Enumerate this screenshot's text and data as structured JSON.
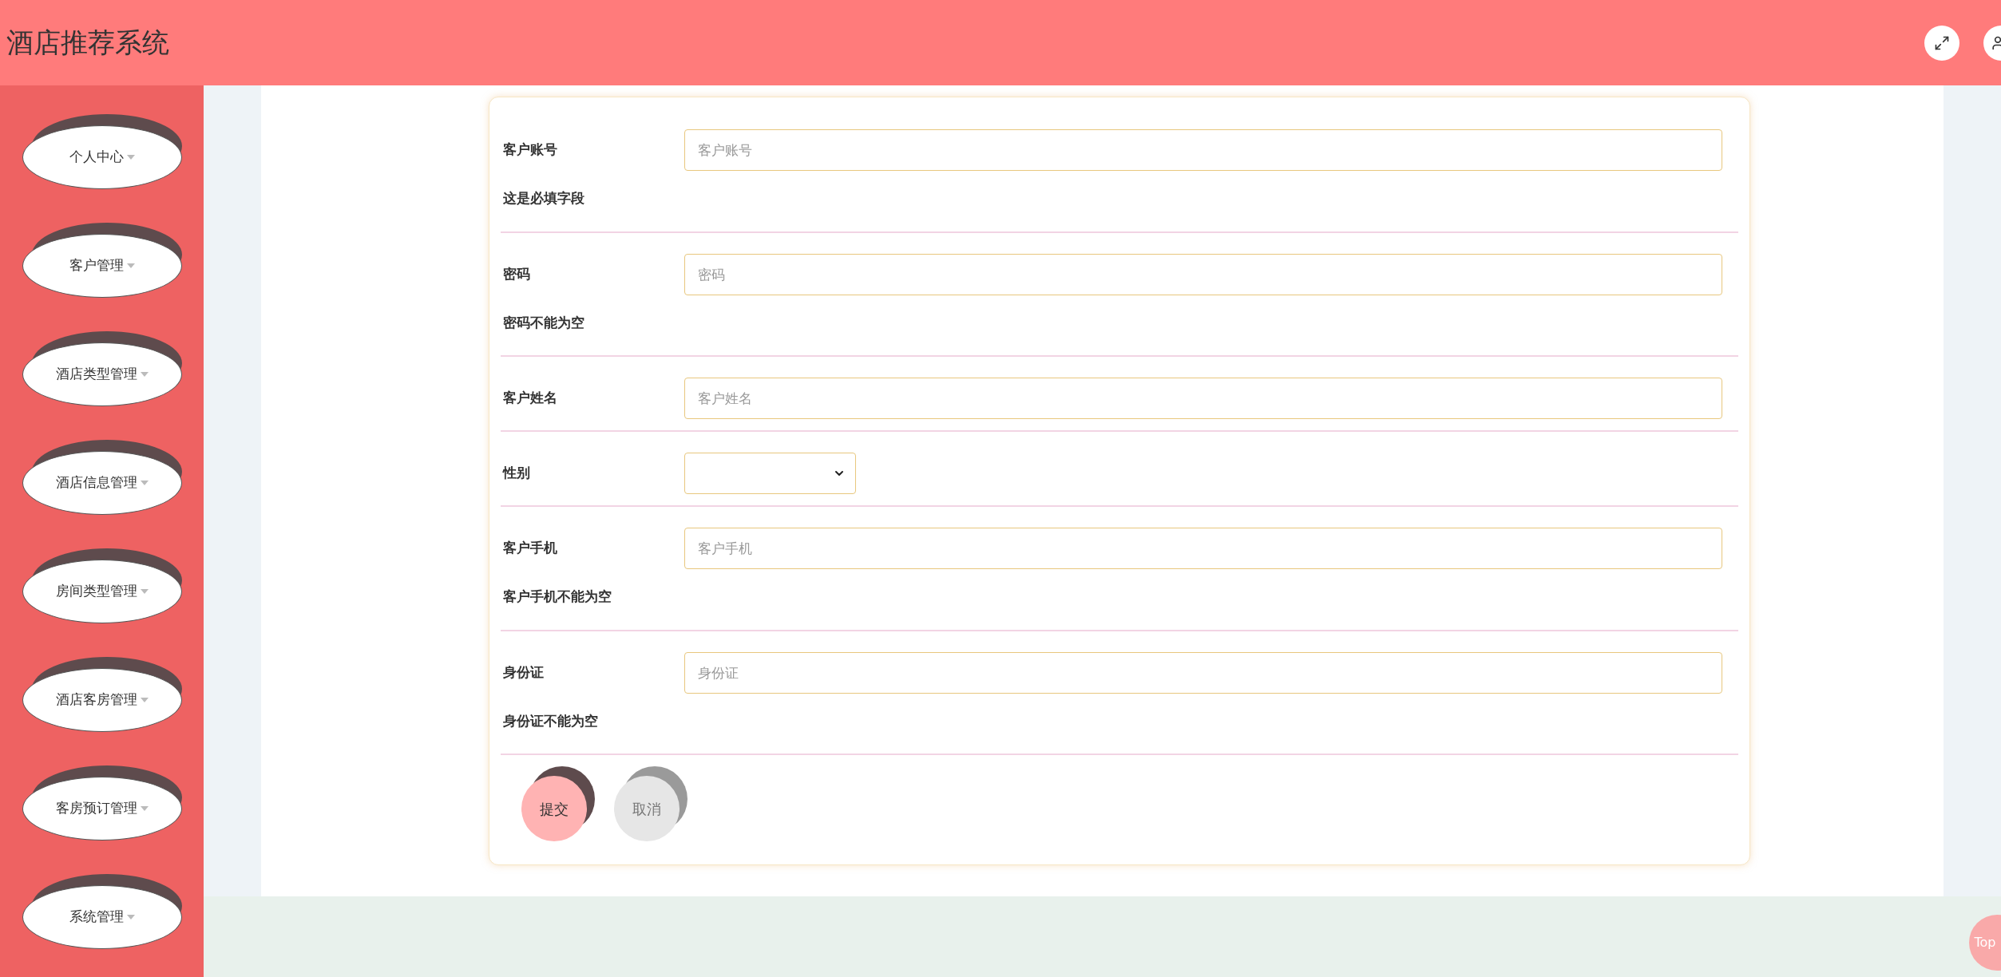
{
  "header": {
    "title": "酒店推荐系统"
  },
  "sidebar": {
    "items": [
      {
        "label": "个人中心"
      },
      {
        "label": "客户管理"
      },
      {
        "label": "酒店类型管理"
      },
      {
        "label": "酒店信息管理"
      },
      {
        "label": "房间类型管理"
      },
      {
        "label": "酒店客房管理"
      },
      {
        "label": "客房预订管理"
      },
      {
        "label": "系统管理"
      }
    ]
  },
  "form": {
    "fields": [
      {
        "kind": "text",
        "label": "客户账号",
        "placeholder": "客户账号",
        "error": "这是必填字段"
      },
      {
        "kind": "text",
        "label": "密码",
        "placeholder": "密码",
        "error": "密码不能为空"
      },
      {
        "kind": "text",
        "label": "客户姓名",
        "placeholder": "客户姓名"
      },
      {
        "kind": "select",
        "label": "性别"
      },
      {
        "kind": "text",
        "label": "客户手机",
        "placeholder": "客户手机",
        "error": "客户手机不能为空"
      },
      {
        "kind": "text",
        "label": "身份证",
        "placeholder": "身份证",
        "error": "身份证不能为空"
      }
    ],
    "buttons": [
      {
        "kind": "primary",
        "label": "提交"
      },
      {
        "kind": "secondary",
        "label": "取消"
      }
    ]
  },
  "back_to_top": {
    "label": "Top"
  }
}
